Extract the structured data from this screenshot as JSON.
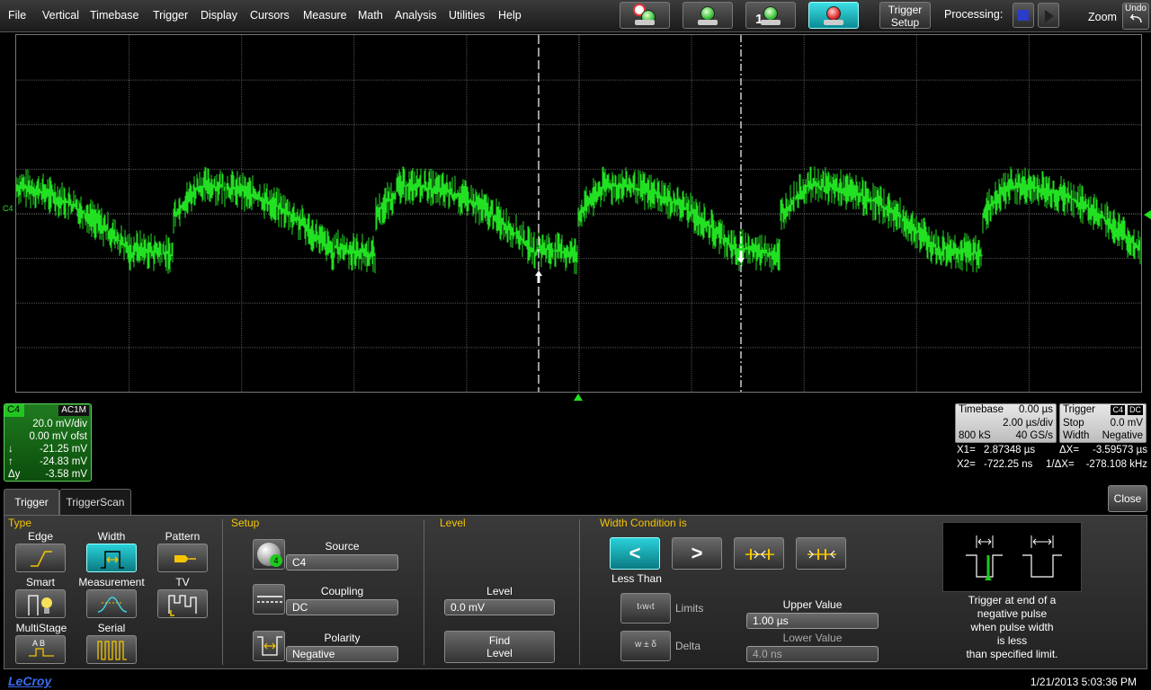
{
  "menu": [
    "File",
    "Vertical",
    "Timebase",
    "Trigger",
    "Display",
    "Cursors",
    "Measure",
    "Math",
    "Analysis",
    "Utilities",
    "Help"
  ],
  "toolbar": {
    "trigger_setup_line1": "Trigger",
    "trigger_setup_line2": "Setup",
    "processing_label": "Processing:",
    "zoom_label": "Zoom",
    "undo_label": "Undo",
    "single_label": "1"
  },
  "channel": {
    "name": "C4",
    "coupling_badge": "AC1M",
    "vdiv": "20.0 mV/div",
    "offset": "0.00 mV ofst",
    "cursor_down_symbol": "↓",
    "cursor_down_value": "-21.25 mV",
    "cursor_up_symbol": "↑",
    "cursor_up_value": "-24.83 mV",
    "delta_symbol": "Δy",
    "delta_value": "-3.58 mV",
    "trace_color": "#22e022",
    "marker_label": "C4"
  },
  "timebase": {
    "label": "Timebase",
    "delay": "0.00 µs",
    "tdiv": "2.00 µs/div",
    "samples": "800 kS",
    "rate": "40 GS/s"
  },
  "trigger_box": {
    "label": "Trigger",
    "source_badge": "C4",
    "coupling_badge": "DC",
    "mode": "Stop",
    "level": "0.0 mV",
    "type": "Width",
    "polarity": "Negative"
  },
  "cursor_readout": {
    "x1_label": "X1=",
    "x1_value": "2.87348 µs",
    "dx_label": "ΔX=",
    "dx_value": "-3.59573 µs",
    "x2_label": "X2=",
    "x2_value": "-722.25 ns",
    "inv_dx_label": "1/ΔX=",
    "inv_dx_value": "-278.108 kHz"
  },
  "tabs": [
    "Trigger",
    "TriggerScan"
  ],
  "close_label": "Close",
  "type_section": {
    "label": "Type",
    "buttons": [
      "Edge",
      "Width",
      "Pattern",
      "Smart",
      "Measurement",
      "TV",
      "MultiStage",
      "Serial"
    ],
    "selected": "Width"
  },
  "setup_section": {
    "label": "Setup",
    "source_label": "Source",
    "source_value": "C4",
    "coupling_label": "Coupling",
    "coupling_value": "DC",
    "polarity_label": "Polarity",
    "polarity_value": "Negative",
    "source_icon_badge": "4"
  },
  "level_section": {
    "label": "Level",
    "level_label": "Level",
    "level_value": "0.0 mV",
    "find_level_line1": "Find",
    "find_level_line2": "Level"
  },
  "width_section": {
    "label": "Width Condition is",
    "less_than_symbol": "<",
    "greater_than_symbol": ">",
    "less_than_label": "Less Than",
    "limits_label": "Limits",
    "delta_label": "Delta",
    "limits_icon_text": "t‹w‹t",
    "delta_icon_text": "w ± δ",
    "upper_label": "Upper Value",
    "upper_value": "1.00 µs",
    "lower_label": "Lower Value",
    "lower_value": "4.0 ns"
  },
  "description": [
    "Trigger at end of a",
    "negative pulse",
    "when pulse width",
    "is less",
    "than specified limit."
  ],
  "footer": {
    "brand": "LeCroy",
    "datetime": "1/21/2013 5:03:36 PM"
  },
  "colors": {
    "accent_cyan": "#1fc7cf",
    "section_yellow": "#f5c400",
    "trace_green": "#22e022"
  }
}
